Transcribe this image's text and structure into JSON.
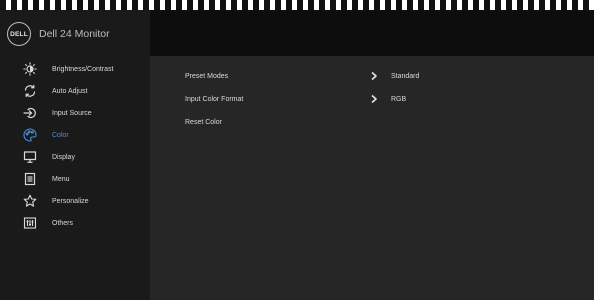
{
  "app": {
    "title": "Dell 24 Monitor",
    "logo_text": "DELL"
  },
  "sidebar": {
    "items": [
      {
        "label": "Brightness/Contrast",
        "icon": "brightness-icon",
        "active": false
      },
      {
        "label": "Auto Adjust",
        "icon": "auto-adjust-icon",
        "active": false
      },
      {
        "label": "Input Source",
        "icon": "input-source-icon",
        "active": false
      },
      {
        "label": "Color",
        "icon": "color-palette-icon",
        "active": true
      },
      {
        "label": "Display",
        "icon": "display-icon",
        "active": false
      },
      {
        "label": "Menu",
        "icon": "menu-icon",
        "active": false
      },
      {
        "label": "Personalize",
        "icon": "star-icon",
        "active": false
      },
      {
        "label": "Others",
        "icon": "others-icon",
        "active": false
      }
    ]
  },
  "content": {
    "rows": [
      {
        "label": "Preset Modes",
        "value": "Standard",
        "has_submenu": true
      },
      {
        "label": "Input Color Format",
        "value": "RGB",
        "has_submenu": true
      },
      {
        "label": "Reset Color",
        "value": "",
        "has_submenu": false
      }
    ]
  },
  "colors": {
    "accent": "#4a90d9",
    "sidebar_bg": "#1a1a1a",
    "content_bg": "#262626",
    "header_bg": "#0d0d0d"
  }
}
